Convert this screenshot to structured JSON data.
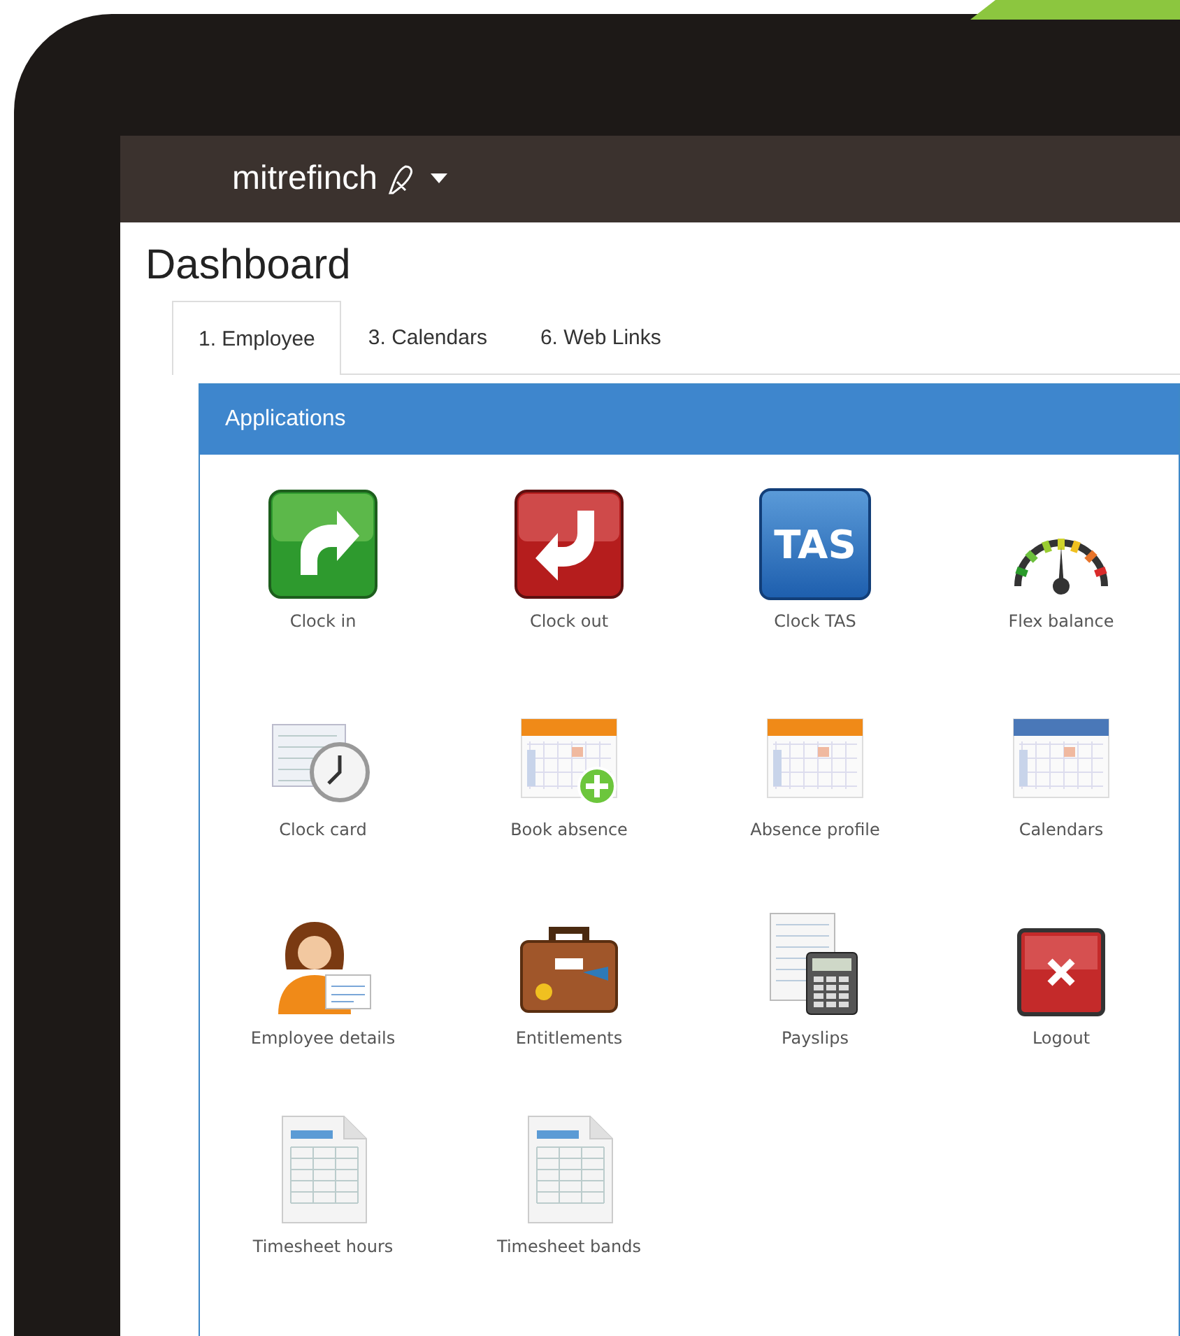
{
  "navbar": {
    "brand": "mitrefinch"
  },
  "page": {
    "title": "Dashboard"
  },
  "tabs": [
    {
      "label": "1. Employee",
      "selected": true
    },
    {
      "label": "3. Calendars",
      "selected": false
    },
    {
      "label": "6. Web Links",
      "selected": false
    }
  ],
  "panel": {
    "title": "Applications",
    "apps": [
      {
        "label": "Clock in",
        "kind": "clock-in"
      },
      {
        "label": "Clock out",
        "kind": "clock-out"
      },
      {
        "label": "Clock TAS",
        "kind": "tas",
        "icon_text": "TAS"
      },
      {
        "label": "Flex balance",
        "kind": "gauge"
      },
      {
        "label": "Clock card",
        "kind": "clock-card"
      },
      {
        "label": "Book absence",
        "kind": "calendar-add"
      },
      {
        "label": "Absence profile",
        "kind": "calendar-orange"
      },
      {
        "label": "Calendars",
        "kind": "calendar-blue"
      },
      {
        "label": "Employee details",
        "kind": "person"
      },
      {
        "label": "Entitlements",
        "kind": "briefcase"
      },
      {
        "label": "Payslips",
        "kind": "calculator"
      },
      {
        "label": "Logout",
        "kind": "logout"
      },
      {
        "label": "Timesheet hours",
        "kind": "sheet"
      },
      {
        "label": "Timesheet bands",
        "kind": "sheet"
      }
    ]
  }
}
